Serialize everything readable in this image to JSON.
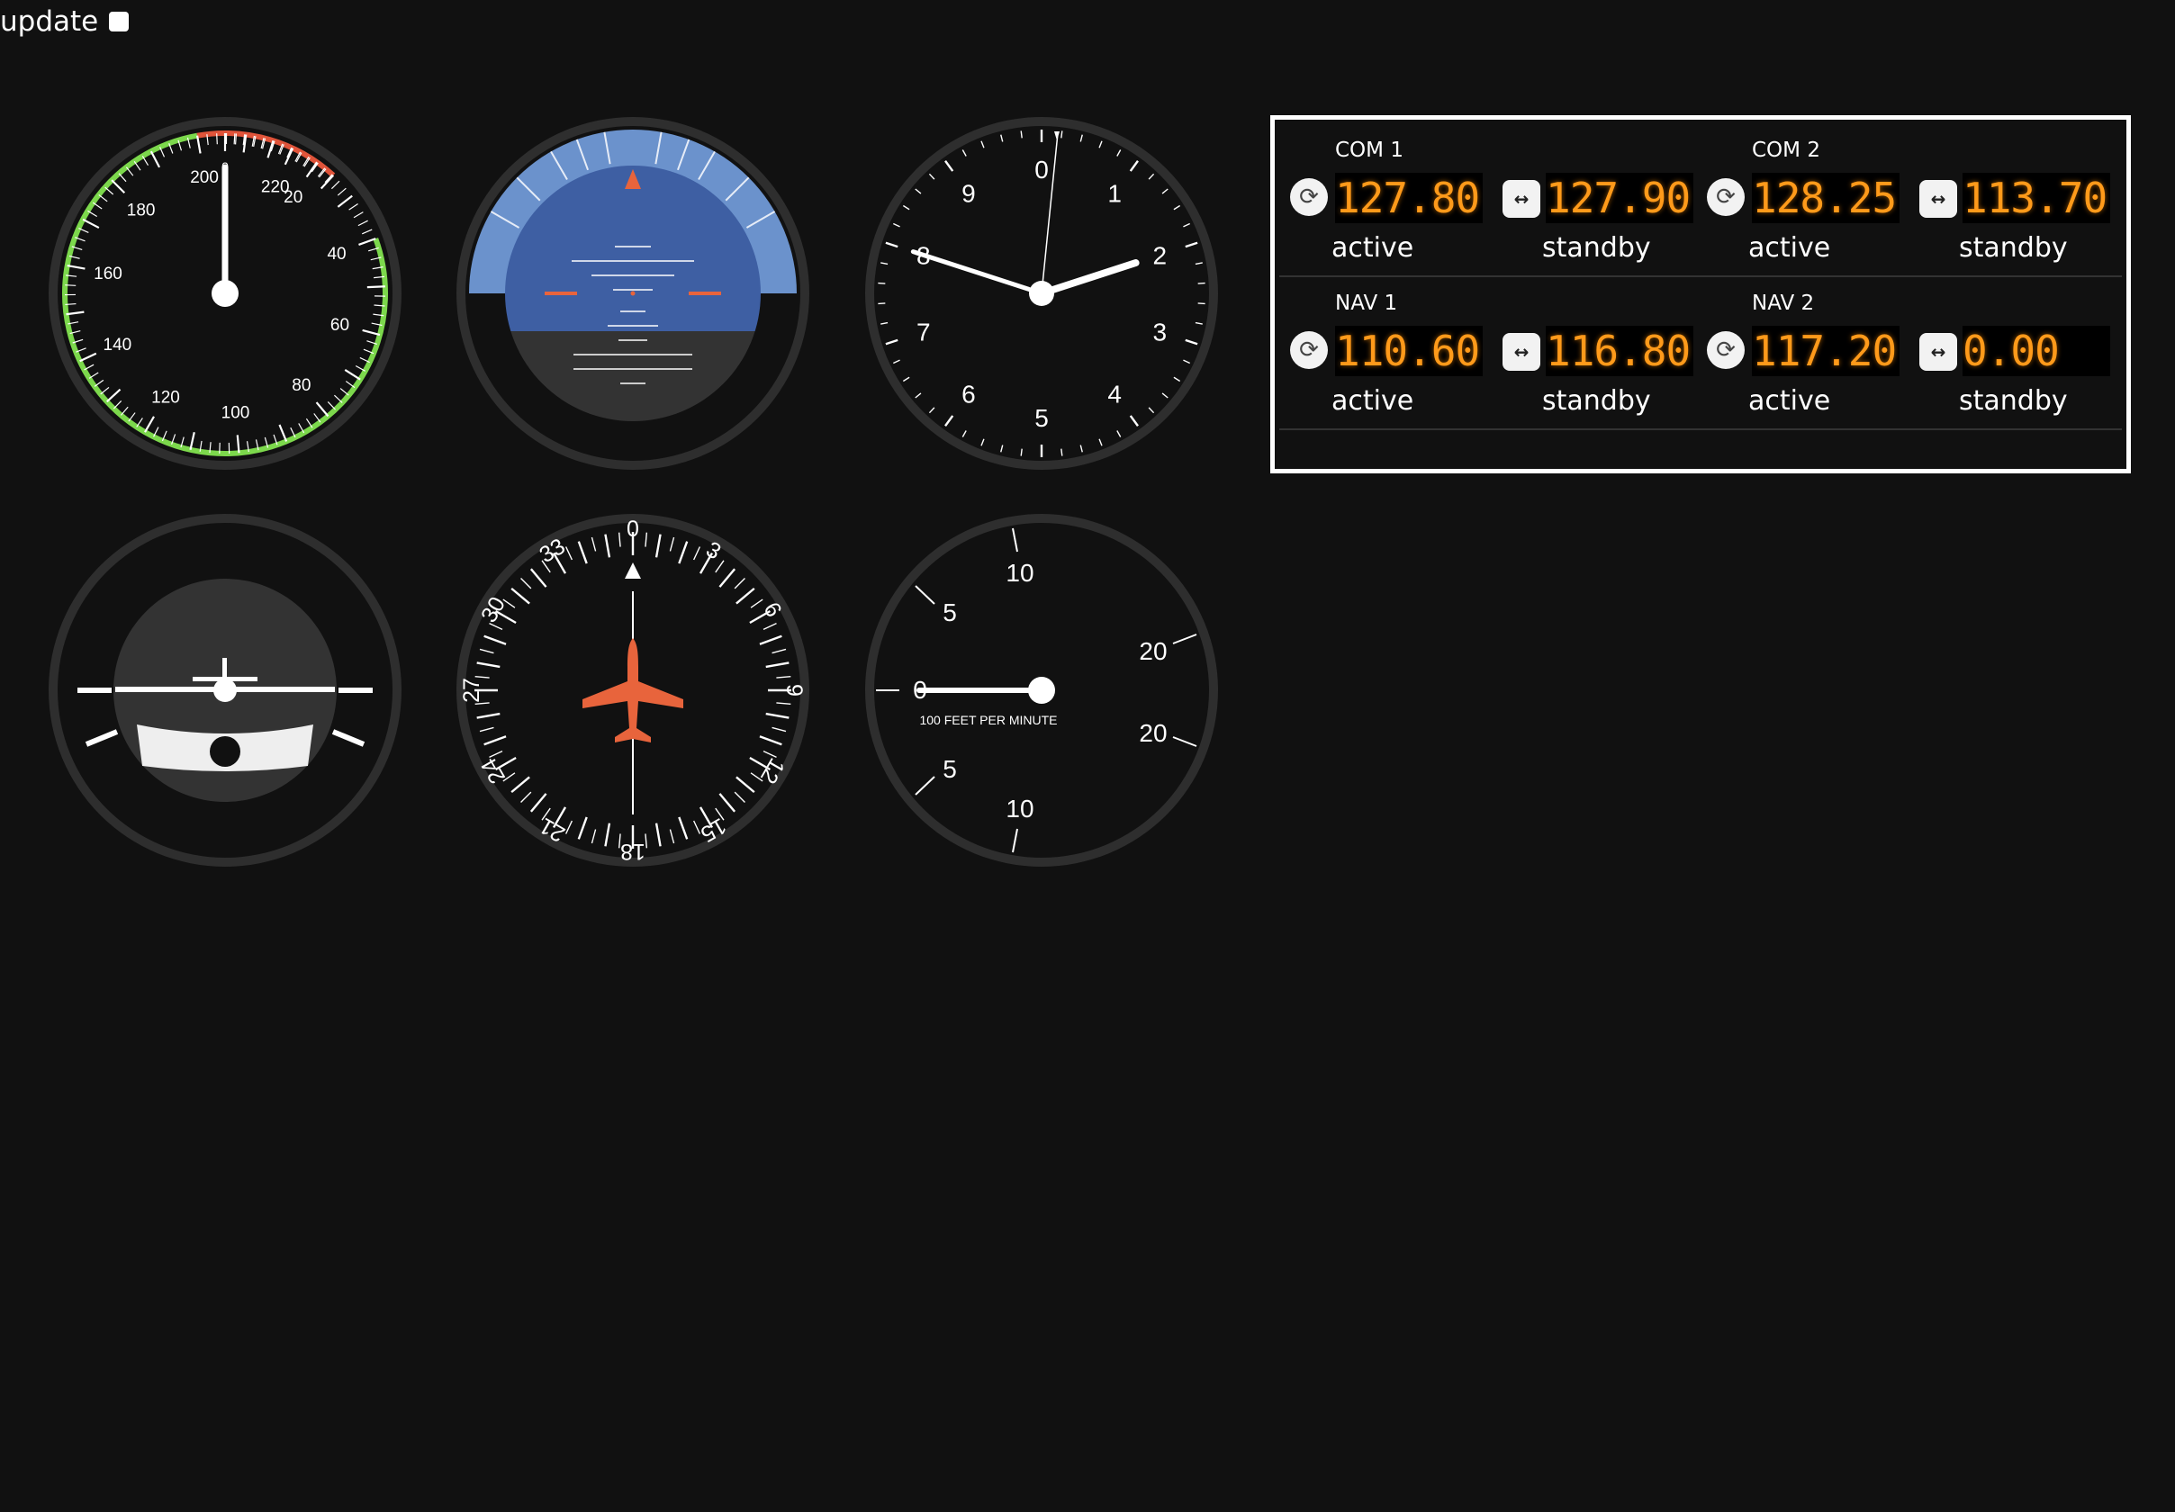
{
  "toolbar": {
    "update_label": "update",
    "update_checked": false
  },
  "airspeed": {
    "value": 0,
    "top_mark": "0",
    "labels": [
      "20",
      "40",
      "60",
      "80",
      "100",
      "120",
      "140",
      "160",
      "180",
      "200",
      "220"
    ],
    "colors": {
      "green_arc": "#7cd84c",
      "red_arc": "#e0543a"
    }
  },
  "attitude": {
    "pitch": 0,
    "roll": 0,
    "colors": {
      "sky": "#3e5fa3",
      "sky_outer": "#6b92cc",
      "ground": "#333333",
      "pointer": "#e8643c"
    }
  },
  "clock": {
    "numerals": [
      "0",
      "1",
      "2",
      "3",
      "4",
      "5",
      "6",
      "7",
      "8",
      "9"
    ],
    "hand_hour": "2",
    "hand_minute": "8",
    "hand_second": "0"
  },
  "turn_coordinator": {
    "turn_rate": 0
  },
  "heading": {
    "heading_deg": 0,
    "labels": [
      "0",
      "3",
      "6",
      "9",
      "12",
      "15",
      "18",
      "21",
      "24",
      "27",
      "30",
      "33"
    ],
    "aircraft_color": "#e8643c"
  },
  "vsi": {
    "value": 0,
    "labels": {
      "zero": "0",
      "up5": "5",
      "up10": "10",
      "up20": "20",
      "dn5": "5",
      "dn10": "10",
      "dn20": "20"
    },
    "units": "100 FEET PER MINUTE"
  },
  "radio": {
    "groups": [
      {
        "name": "COM 1",
        "active": "127.80",
        "standby": "127.90"
      },
      {
        "name": "COM 2",
        "active": "128.25",
        "standby": "113.70"
      },
      {
        "name": "NAV 1",
        "active": "110.60",
        "standby": "116.80"
      },
      {
        "name": "NAV 2",
        "active": "117.20",
        "standby": "0.00"
      }
    ],
    "active_label": "active",
    "standby_label": "standby",
    "swap_icon": "swap-icon",
    "transfer_icon": "transfer-icon",
    "digit_color": "#ff9a1a"
  }
}
